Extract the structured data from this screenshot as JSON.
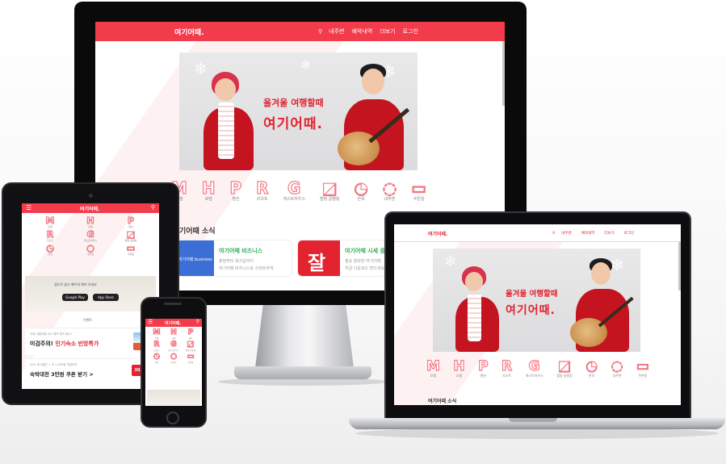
{
  "brand": {
    "logo_text": "여기어때.",
    "accent": "#f23c4c",
    "logo_red": "#e3232f"
  },
  "nav": {
    "search_icon": "search-icon",
    "links": [
      "내주변",
      "예약내역",
      "더보기",
      "로그인"
    ]
  },
  "banner": {
    "subtitle": "올겨울 여행할때",
    "logo": "여기어때."
  },
  "categories": [
    {
      "glyph": "M",
      "label": "모텔"
    },
    {
      "glyph": "H",
      "label": "호텔"
    },
    {
      "glyph": "P",
      "label": "펜션"
    },
    {
      "glyph": "R",
      "label": "리조트"
    },
    {
      "glyph": "G",
      "label": "게스트하우스"
    },
    {
      "glyph": "◩",
      "label": "캠핑·글램핑"
    },
    {
      "glyph": "◔",
      "label": "한옥"
    },
    {
      "glyph": "◌",
      "label": "내주변"
    },
    {
      "glyph": "▭",
      "label": "쿠폰함"
    }
  ],
  "news": {
    "title": "여기어때 소식",
    "title_partial": "기어때 소식",
    "cards": [
      {
        "title": "여기어때 비즈니스",
        "lines": [
          "출장부터 워크샵까지",
          "여기어때 비즈니스로 스마트하게"
        ],
        "thumb_text": "여기어때 business"
      },
      {
        "title": "여기어때 시세 중",
        "lines": [
          "필요 정보만 여기어때",
          "지금 다운로드 받으세요"
        ],
        "thumb_text": "잘"
      }
    ]
  },
  "tablet": {
    "app_banner": "앱으로 쉽고 빠르게 예약 하세요",
    "app_stores": [
      "Google Play",
      "App Store"
    ],
    "section_label": "이벤트",
    "promos": [
      {
        "small": "이제 겨울여행 숙소 예약 준비 됐나?",
        "big_plain": "미검주의! ",
        "big_red": "인기숙소 빈방특가"
      },
      {
        "small": "20% 즉시할인 + 쿠 1,000원 적립까지",
        "big_plain": "숙박대전 3만원 쿠폰 받기 >",
        "big_red": "",
        "badge": "30,000"
      }
    ]
  }
}
